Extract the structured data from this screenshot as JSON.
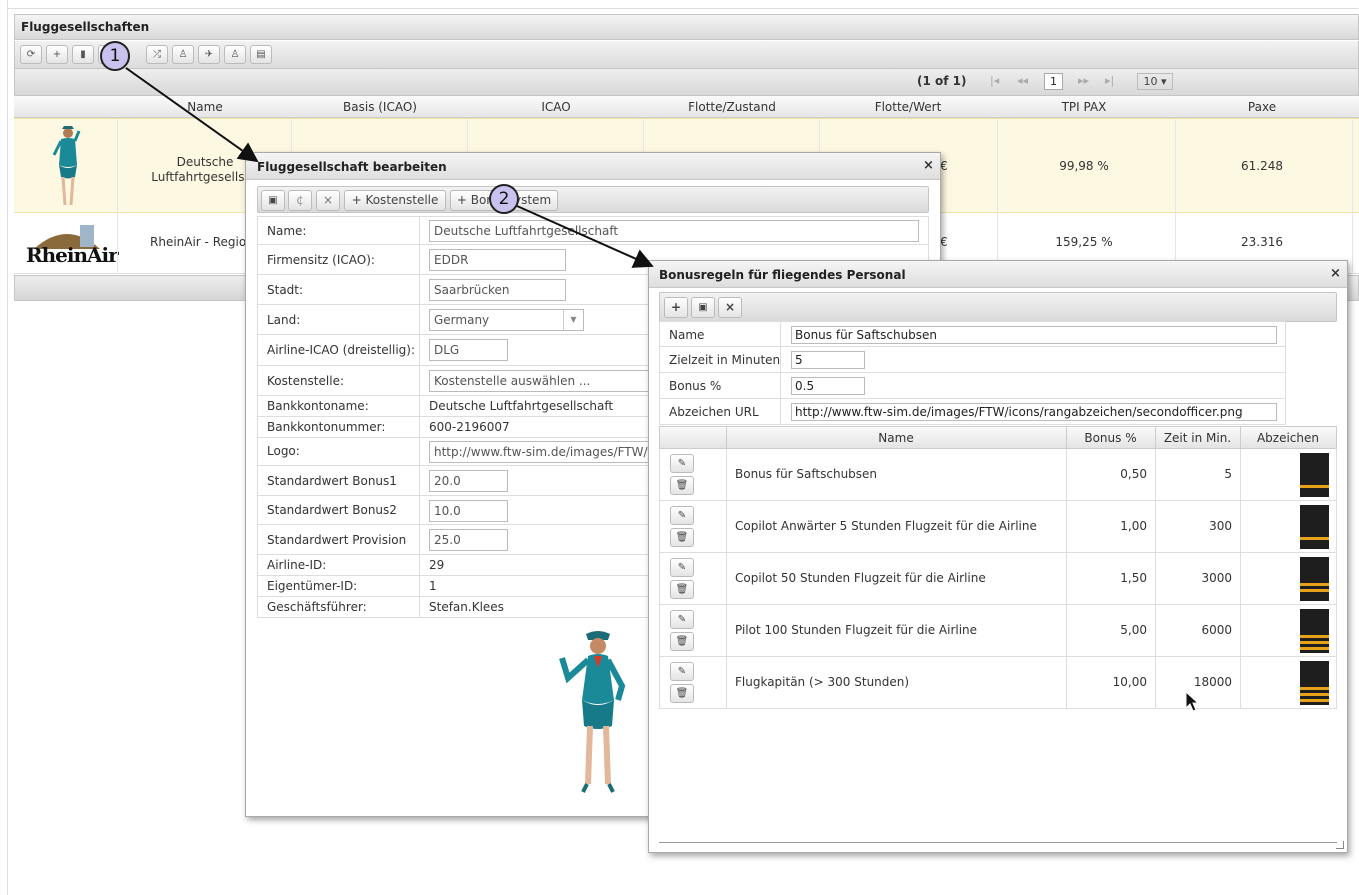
{
  "main": {
    "title": "Fluggesellschaften",
    "toolbar_icons": [
      "refresh-icon",
      "plus-icon",
      "trash-icon",
      "edit-icon",
      "shuffle-icon",
      "person-icon",
      "plane-icon",
      "person-icon",
      "table-icon"
    ],
    "pager": {
      "info": "(1 of 1)",
      "first": "|◂",
      "prev": "◂◂",
      "page": "1",
      "next": "▸▸",
      "last": "▸|",
      "rows_per_page": "10 ▾"
    },
    "columns": [
      "Name",
      "Basis (ICAO)",
      "ICAO",
      "Flotte/Zustand",
      "Flotte/Wert",
      "TPI PAX",
      "Paxe"
    ],
    "rows": [
      {
        "name_line1": "Deutsche",
        "name_line2": "Luftfahrtgesellsch",
        "wert": "€",
        "tpi": "99,98 %",
        "paxe": "61.248"
      },
      {
        "name_line1": "RheinAir - Region",
        "wert": "€",
        "tpi": "159,25 %",
        "paxe": "23.316",
        "logo_text": "RheinAir"
      }
    ]
  },
  "dialog1": {
    "title": "Fluggesellschaft bearbeiten",
    "close": "×",
    "toolbar": {
      "save": "▣",
      "reload": "¢",
      "close": "×",
      "kostenstelle": "+ Kostenstelle",
      "bonussystem": "+ Bonussystem"
    },
    "fields": [
      {
        "label": "Name:",
        "value": "Deutsche Luftfahrtgesellschaft"
      },
      {
        "label": "Firmensitz (ICAO):",
        "value": "EDDR"
      },
      {
        "label": "Stadt:",
        "value": "Saarbrücken"
      },
      {
        "label": "Land:",
        "value": "Germany"
      },
      {
        "label": "Airline-ICAO (dreistellig):",
        "value": "DLG"
      },
      {
        "label": "Kostenstelle:",
        "value": "Kostenstelle auswählen ..."
      },
      {
        "label": "Bankkontoname:",
        "value": "Deutsche Luftfahrtgesellschaft"
      },
      {
        "label": "Bankkontonummer:",
        "value": "600-2196007"
      },
      {
        "label": "Logo:",
        "value": "http://www.ftw-sim.de/images/FTW/f"
      },
      {
        "label": "Standardwert Bonus1",
        "value": "20.0"
      },
      {
        "label": "Standardwert Bonus2",
        "value": "10.0"
      },
      {
        "label": "Standardwert Provision",
        "value": "25.0"
      },
      {
        "label": "Airline-ID:",
        "value": "29"
      },
      {
        "label": "Eigentümer-ID:",
        "value": "1"
      },
      {
        "label": "Geschäftsführer:",
        "value": "Stefan.Klees"
      }
    ]
  },
  "dialog2": {
    "title": "Bonusregeln für fliegendes Personal",
    "close": "×",
    "toolbar": {
      "add": "+",
      "save": "▣",
      "close": "×"
    },
    "form": [
      {
        "label": "Name",
        "value": "Bonus für Saftschubsen"
      },
      {
        "label": "Zielzeit in Minuten",
        "value": "5"
      },
      {
        "label": "Bonus %",
        "value": "0.5"
      },
      {
        "label": "Abzeichen URL",
        "value": "http://www.ftw-sim.de/images/FTW/icons/rangabzeichen/secondofficer.png"
      }
    ],
    "columns": {
      "name": "Name",
      "bonus": "Bonus %",
      "zeit": "Zeit in Min.",
      "abzeichen": "Abzeichen"
    },
    "rows": [
      {
        "name": "Bonus für Saftschubsen",
        "bonus": "0,50",
        "zeit": "5",
        "stripes": 1
      },
      {
        "name": "Copilot Anwärter 5 Stunden Flugzeit für die Airline",
        "bonus": "1,00",
        "zeit": "300",
        "stripes": 1
      },
      {
        "name": "Copilot 50 Stunden Flugzeit für die Airline",
        "bonus": "1,50",
        "zeit": "3000",
        "stripes": 2
      },
      {
        "name": "Pilot 100 Stunden Flugzeit für die Airline",
        "bonus": "5,00",
        "zeit": "6000",
        "stripes": 3
      },
      {
        "name": "Flugkapitän (> 300 Stunden)",
        "bonus": "10,00",
        "zeit": "18000",
        "stripes": 3
      }
    ],
    "row_icons": {
      "edit": "✎",
      "delete": "🗑"
    }
  },
  "annotations": {
    "marker1": "1",
    "marker2": "2"
  },
  "colors": {
    "selected_row": "#fdf8e1",
    "marker_fill": "#c9c2ee",
    "stripe": "#e8a21a"
  }
}
